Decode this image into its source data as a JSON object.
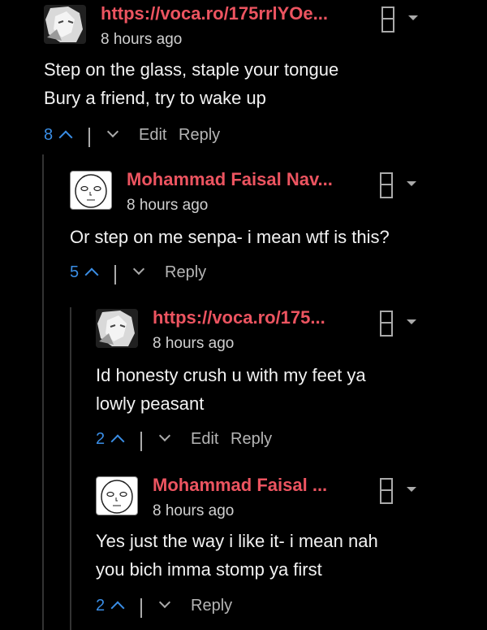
{
  "comments": [
    {
      "author": "https://voca.ro/175rrlYOe...",
      "time": "8 hours ago",
      "lines": [
        "Step on the glass, staple your tongue",
        "Bury a friend, try to wake up"
      ],
      "votes": "8",
      "edit": "Edit",
      "reply": "Reply",
      "author_color": "#ec5460",
      "avatar": "anime-avatar"
    },
    {
      "author": "Mohammad Faisal Nav...",
      "time": "8 hours ago",
      "lines": [
        "Or step on me senpa- i mean wtf is this?"
      ],
      "votes": "5",
      "reply": "Reply",
      "author_color": "#ec5460",
      "avatar": "face-avatar"
    },
    {
      "author": "https://voca.ro/175...",
      "time": "8 hours ago",
      "lines": [
        "Id honesty crush u with my feet ya",
        "lowly peasant"
      ],
      "votes": "2",
      "edit": "Edit",
      "reply": "Reply",
      "author_color": "#ec5460",
      "avatar": "anime-avatar"
    },
    {
      "author": "Mohammad Faisal ...",
      "time": "8 hours ago",
      "lines": [
        "Yes just the way i like it- i mean nah",
        "you bich imma stomp ya first"
      ],
      "votes": "2",
      "reply": "Reply",
      "author_color": "#ec5460",
      "avatar": "face-avatar"
    }
  ],
  "colors": {
    "background": "#000000",
    "accent": "#3a8ee6",
    "author": "#ec5460"
  }
}
